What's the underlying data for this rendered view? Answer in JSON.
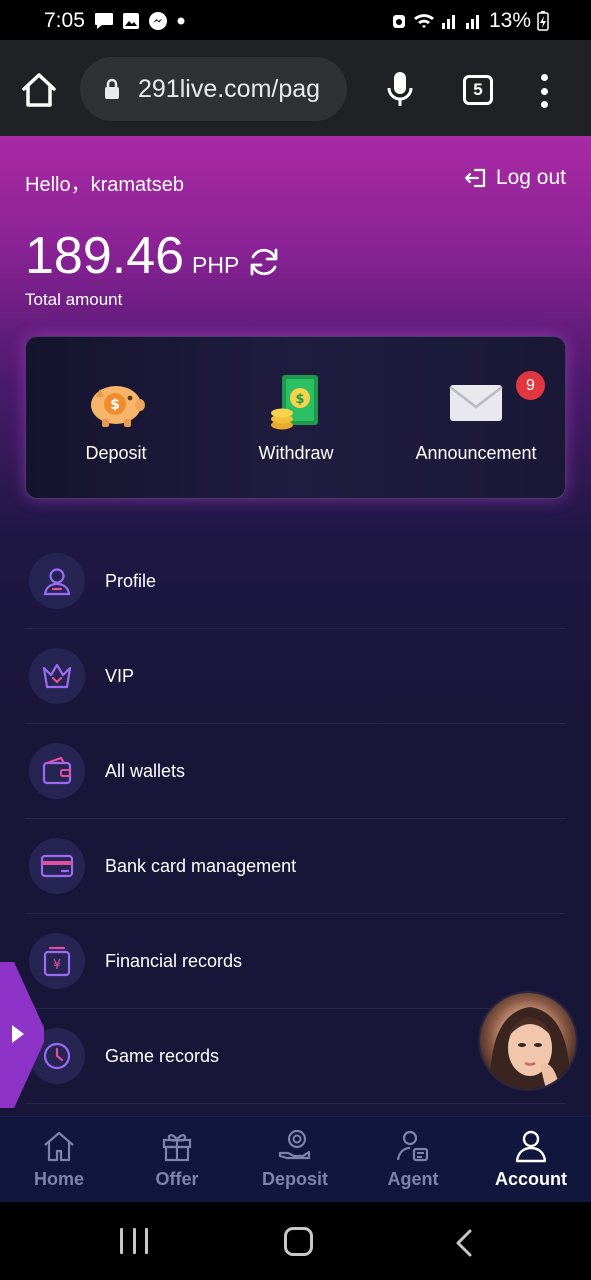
{
  "status_bar": {
    "time": "7:05",
    "battery": "13%"
  },
  "browser": {
    "url": "291live.com/pag",
    "tab_count": "5"
  },
  "header": {
    "greeting": "Hello，kramatseb",
    "logout_label": "Log out"
  },
  "balance": {
    "amount": "189.46",
    "currency": "PHP",
    "label": "Total amount"
  },
  "actions": [
    {
      "label": "Deposit",
      "icon": "piggy-bank-icon"
    },
    {
      "label": "Withdraw",
      "icon": "money-coins-icon"
    },
    {
      "label": "Announcement",
      "icon": "envelope-icon",
      "badge": "9"
    }
  ],
  "menu": [
    {
      "label": "Profile",
      "icon": "user-icon"
    },
    {
      "label": "VIP",
      "icon": "crown-icon"
    },
    {
      "label": "All wallets",
      "icon": "wallet-icon"
    },
    {
      "label": "Bank card management",
      "icon": "card-icon"
    },
    {
      "label": "Financial records",
      "icon": "yen-box-icon"
    },
    {
      "label": "Game records",
      "icon": "clock-icon"
    }
  ],
  "bottom_nav": [
    {
      "label": "Home",
      "icon": "home-icon"
    },
    {
      "label": "Offer",
      "icon": "gift-icon"
    },
    {
      "label": "Deposit",
      "icon": "coin-hand-icon"
    },
    {
      "label": "Agent",
      "icon": "agent-icon"
    },
    {
      "label": "Account",
      "icon": "account-icon",
      "active": true
    }
  ],
  "colors": {
    "accent": "#a92aa6",
    "page_bg": "#181638",
    "badge": "#e0383e",
    "icon_purple": "#8b5cf6"
  }
}
